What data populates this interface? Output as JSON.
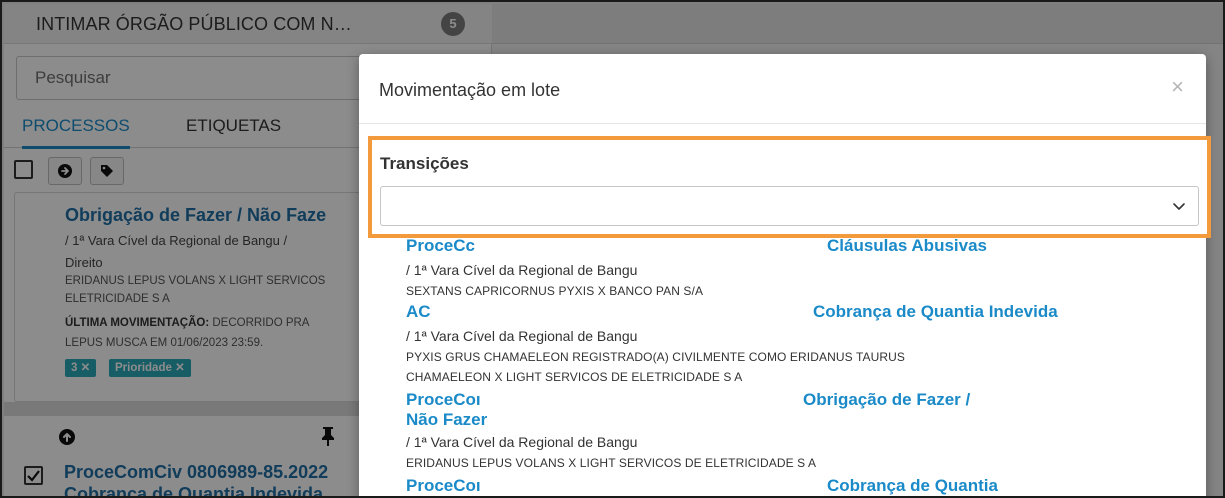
{
  "left_panel": {
    "header_title": "INTIMAR ÓRGÃO PÚBLICO COM N…",
    "badge": "5",
    "search_placeholder": "Pesquisar",
    "tabs": [
      {
        "label": "PROCESSOS"
      },
      {
        "label": "ETIQUETAS"
      }
    ],
    "toolbar_icons": [
      "checkbox-icon",
      "arrow-circle-right-icon",
      "tag-icon"
    ],
    "card": {
      "title": "Obrigação de Fazer / Não Faze",
      "court": "/ 1ª Vara Cível da Regional de Bangu /",
      "direito": "Direito",
      "parties_line1": "ERIDANUS LEPUS VOLANS X LIGHT SERVICOS",
      "parties_line2": "ELETRICIDADE S A",
      "last_move_label": "ÚLTIMA MOVIMENTAÇÃO:",
      "last_move_text": "DECORRIDO PRA",
      "last_move_line2": "LEPUS MUSCA EM 01/06/2023 23:59.",
      "tags": [
        "3 ✕",
        "Prioridade ✕"
      ]
    },
    "row_icons": [
      "arrow-up-circle-icon",
      "pin-icon"
    ],
    "row2_title": "ProceComCiv 0806989-85.2022",
    "row2_sub": "Cobrança de Quantia Indevida"
  },
  "modal": {
    "title": "Movimentação em lote",
    "close": "×",
    "transitions_label": "Transições",
    "select_value": "",
    "results": [
      {
        "title_head": "ProceCc",
        "title_tail": "Cláusulas Abusivas",
        "court": "/ 1ª Vara Cível da Regional de Bangu",
        "parties": [
          "SEXTANS CAPRICORNUS PYXIS X BANCO PAN S/A"
        ]
      },
      {
        "title_head": "AC",
        "title_tail": "Cobrança de Quantia Indevida",
        "court": "/ 1ª Vara Cível da Regional de Bangu",
        "parties": [
          "PYXIS GRUS CHAMAELEON REGISTRADO(A) CIVILMENTE COMO ERIDANUS TAURUS",
          "CHAMAELEON X LIGHT SERVICOS DE ELETRICIDADE S A"
        ]
      },
      {
        "title_head": "ProceCoı",
        "title_tail": "Obrigação de Fazer /",
        "title_line2": "Não Fazer",
        "court": "/ 1ª Vara Cível da Regional de Bangu",
        "parties": [
          "ERIDANUS LEPUS VOLANS X LIGHT SERVICOS DE ELETRICIDADE S A"
        ]
      },
      {
        "title_head": "ProceCoı",
        "title_tail": "Cobrança de Quantia"
      }
    ]
  },
  "colors": {
    "link": "#1a8ac8",
    "highlight": "#f39a3c",
    "tag": "#2aa9b9"
  }
}
